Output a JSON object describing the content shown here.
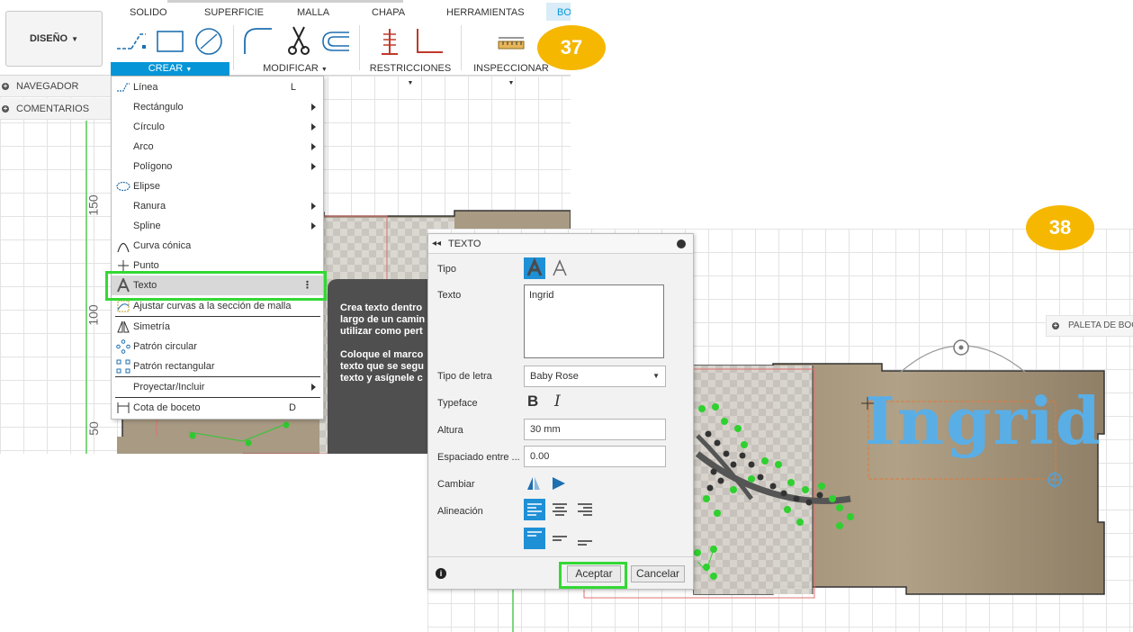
{
  "badges": {
    "left": "37",
    "right": "38"
  },
  "toolbar": {
    "tabs": [
      "SOLIDO",
      "SUPERFICIE",
      "MALLA",
      "CHAPA",
      "HERRAMIENTAS",
      "BO"
    ],
    "design_label": "DISEÑO",
    "groups": [
      "CREAR",
      "MODIFICAR",
      "RESTRICCIONES",
      "INSPECCIONAR"
    ]
  },
  "browser": {
    "navigator": "NAVEGADOR",
    "comments": "COMENTARIOS"
  },
  "ruler": {
    "ticks": [
      "150",
      "100",
      "50"
    ]
  },
  "crear_menu": {
    "items": [
      {
        "label": "Línea",
        "shortcut": "L"
      },
      {
        "label": "Rectángulo"
      },
      {
        "label": "Círculo"
      },
      {
        "label": "Arco"
      },
      {
        "label": "Polígono"
      },
      {
        "label": "Elipse"
      },
      {
        "label": "Ranura"
      },
      {
        "label": "Spline"
      },
      {
        "label": "Curva cónica"
      },
      {
        "label": "Punto"
      },
      {
        "label": "Texto"
      },
      {
        "label": "Ajustar curvas a la sección de malla"
      },
      {
        "label": "Simetría"
      },
      {
        "label": "Patrón circular"
      },
      {
        "label": "Patrón rectangular"
      },
      {
        "label": "Proyectar/Incluir"
      },
      {
        "label": "Cota de boceto",
        "shortcut": "D"
      }
    ]
  },
  "tooltip": {
    "p1": "Crea texto dentro\nlargo de un camin\nutilizar como pert",
    "p2": "Coloque el marco\ntexto que se segu\ntexto y asígnele c"
  },
  "palette": {
    "label": "PALETA DE BOC"
  },
  "dialog": {
    "title": "TEXTO",
    "labels": {
      "tipo": "Tipo",
      "texto": "Texto",
      "font": "Tipo de letra",
      "typeface": "Typeface",
      "height": "Altura",
      "spacing": "Espaciado entre ...",
      "flip": "Cambiar",
      "align": "Alineación"
    },
    "texto_value": "Ingrid",
    "font_value": "Baby Rose",
    "height_value": "30 mm",
    "spacing_value": "0.00",
    "bold_glyph": "B",
    "italic_glyph": "I",
    "accept": "Aceptar",
    "cancel": "Cancelar"
  },
  "canvas": {
    "text": "Ingrid",
    "text_color": "#5aaee6"
  },
  "colors": {
    "accent": "#0696d7",
    "highlight": "#34d834",
    "badge": "#f5b700",
    "wood": "#a4937a"
  }
}
